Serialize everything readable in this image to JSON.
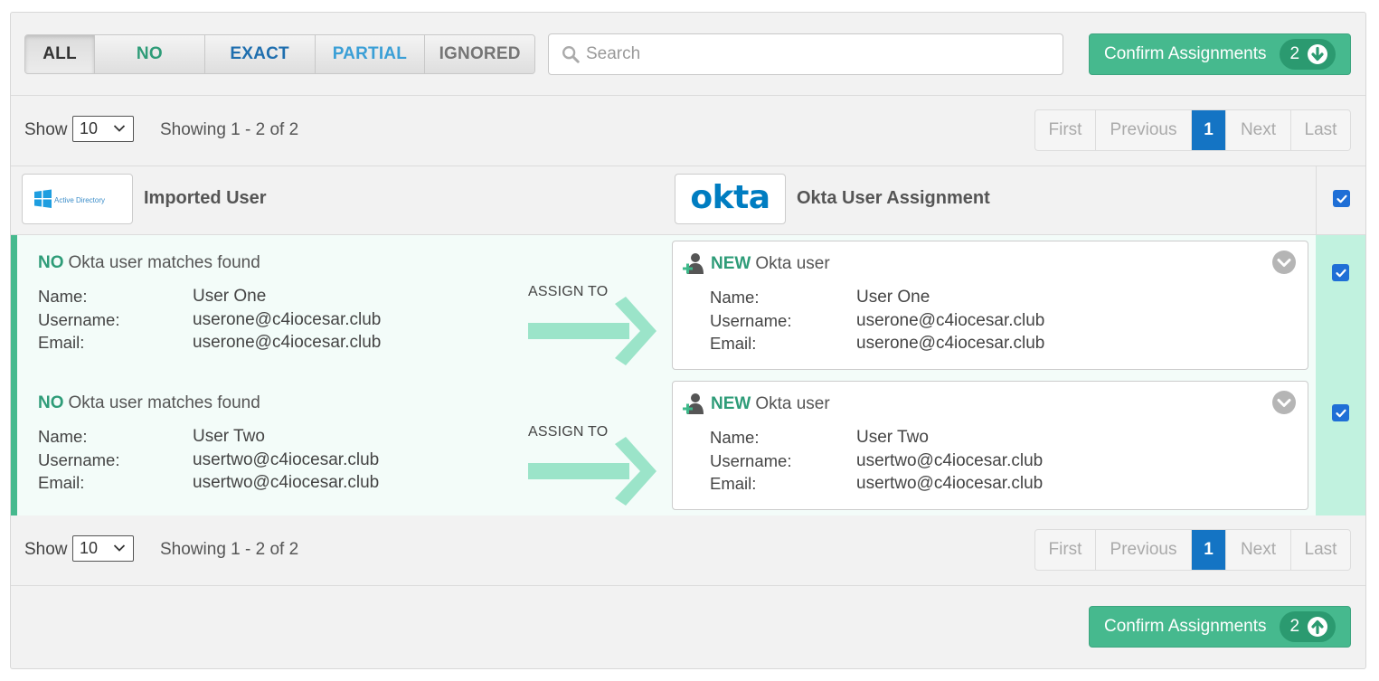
{
  "filters": {
    "all": "ALL",
    "no": "NO",
    "exact": "EXACT",
    "partial": "PARTIAL",
    "ignored": "IGNORED",
    "active": "all"
  },
  "search": {
    "placeholder": "Search",
    "value": ""
  },
  "confirm": {
    "label": "Confirm Assignments",
    "count": "2"
  },
  "pager": {
    "show_label": "Show",
    "page_size": "10",
    "showing": "Showing 1 - 2 of 2",
    "first": "First",
    "previous": "Previous",
    "current": "1",
    "next": "Next",
    "last": "Last"
  },
  "header": {
    "ad_logo_text": "Active Directory",
    "imported_title": "Imported User",
    "okta_logo_text": "okta",
    "okta_title": "Okta User Assignment",
    "select_all_checked": true
  },
  "labels": {
    "no_word": "NO",
    "no_match_text": "Okta user matches found",
    "name": "Name:",
    "username": "Username:",
    "email": "Email:",
    "assign_to": "ASSIGN TO",
    "new_word": "NEW",
    "okta_user": "Okta user"
  },
  "rows": [
    {
      "name": "User One",
      "username": "userone@c4iocesar.club",
      "email": "userone@c4iocesar.club",
      "okta_name": "User One",
      "okta_username": "userone@c4iocesar.club",
      "okta_email": "userone@c4iocesar.club",
      "checked": true
    },
    {
      "name": "User Two",
      "username": "usertwo@c4iocesar.club",
      "email": "usertwo@c4iocesar.club",
      "okta_name": "User Two",
      "okta_username": "usertwo@c4iocesar.club",
      "okta_email": "usertwo@c4iocesar.club",
      "checked": true
    }
  ],
  "colors": {
    "accent_green": "#46b98e",
    "no_green": "#2e9c78",
    "exact_blue": "#1e6eae",
    "partial_blue": "#3a9fd6",
    "page_active": "#1474c4",
    "checkbox_blue": "#1f6fd6",
    "okta_blue": "#007dc1"
  }
}
